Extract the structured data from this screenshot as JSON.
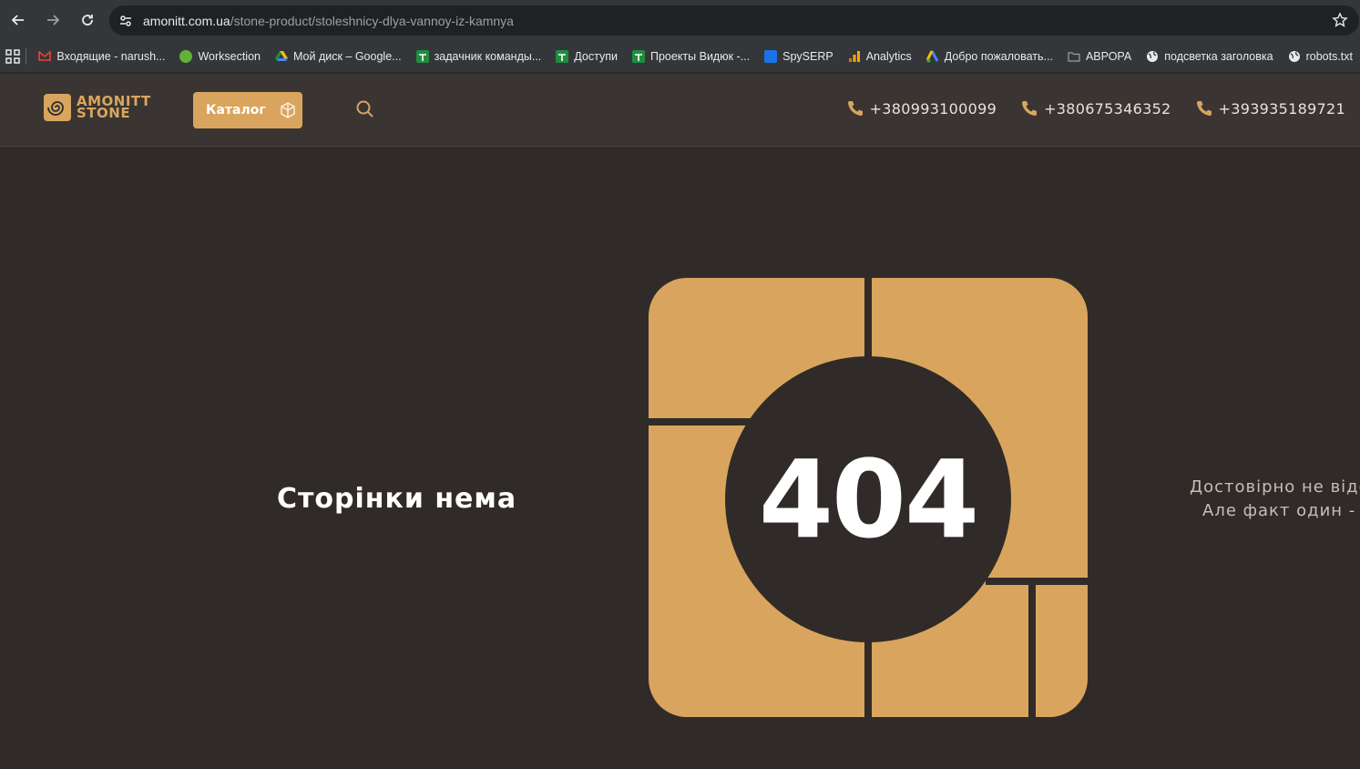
{
  "browser": {
    "url_host": "amonitt.com.ua",
    "url_path": "/stone-product/stoleshnicy-dlya-vannoy-iz-kamnya",
    "bookmarks": [
      {
        "label": "Входящие - narush...",
        "icon": "gmail-icon",
        "color": "#ea4335"
      },
      {
        "label": "Worksection",
        "icon": "worksection-icon",
        "color": "#5fb235"
      },
      {
        "label": "Мой диск – Google...",
        "icon": "google-drive-icon",
        "color": "#fbbc04"
      },
      {
        "label": "задачник команды...",
        "icon": "sheets-icon",
        "color": "#1e8e3e"
      },
      {
        "label": "Доступи",
        "icon": "sheets-icon",
        "color": "#1e8e3e"
      },
      {
        "label": "Проекты Видюк -...",
        "icon": "sheets-icon",
        "color": "#1e8e3e"
      },
      {
        "label": "SpySERP",
        "icon": "spyserp-icon",
        "color": "#1a73e8"
      },
      {
        "label": "Analytics",
        "icon": "analytics-icon",
        "color": "#f9ab00"
      },
      {
        "label": "Добро пожаловать...",
        "icon": "ads-icon",
        "color": "#4285f4"
      },
      {
        "label": "АВРОРА",
        "icon": "folder-icon",
        "color": "#9aa0a6"
      },
      {
        "label": "подсветка заголовка",
        "icon": "globe-icon",
        "color": "#e8eaed"
      },
      {
        "label": "robots.txt",
        "icon": "globe-icon",
        "color": "#e8eaed"
      }
    ]
  },
  "header": {
    "logo_line1": "AMONITT",
    "logo_line2": "STONE",
    "catalog_label": "Каталог",
    "phones": [
      "+380993100099",
      "+380675346352",
      "+393935189721"
    ]
  },
  "main": {
    "title": "Сторінки нема",
    "code": "404",
    "side_line1": "Достовірно не відом",
    "side_line2": "Але факт один - ст"
  },
  "colors": {
    "accent": "#d9a55e",
    "background": "#302b28",
    "header_bg": "#3a3532"
  }
}
